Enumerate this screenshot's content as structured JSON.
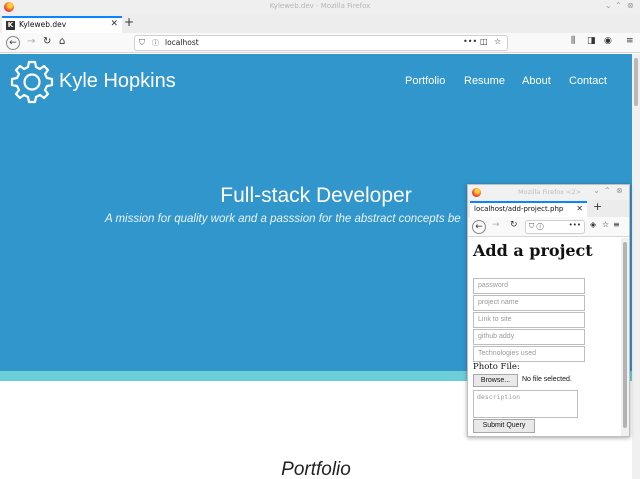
{
  "browser": {
    "window_title": "Kyleweb.dev - Mozilla Firefox",
    "tab_label": "Kyleweb.dev",
    "tab_favicon": "K",
    "url": "localhost"
  },
  "site": {
    "brand": "Kyle Hopkins",
    "nav": [
      "Portfolio",
      "Resume",
      "About",
      "Contact"
    ],
    "hero_title": "Full-stack Developer",
    "hero_subtitle": "A mission for quality work and a passsion for the abstract concepts be",
    "section_title": "Portfolio",
    "colors": {
      "hero": "#3196cb",
      "accent_strip": "#6ccfd8"
    }
  },
  "popup": {
    "window_title": "Mozilla Firefox <2>",
    "tab_label": "localhost/add-project.php",
    "heading": "Add a project",
    "fields": [
      {
        "placeholder": "password"
      },
      {
        "placeholder": "project name"
      },
      {
        "placeholder": "Link to site"
      },
      {
        "placeholder": "github addy"
      },
      {
        "placeholder": "Technologies used"
      }
    ],
    "photo_label": "Photo File:",
    "browse_label": "Browse...",
    "no_file": "No file selected.",
    "description_placeholder": "description",
    "submit_label": "Submit Query"
  }
}
